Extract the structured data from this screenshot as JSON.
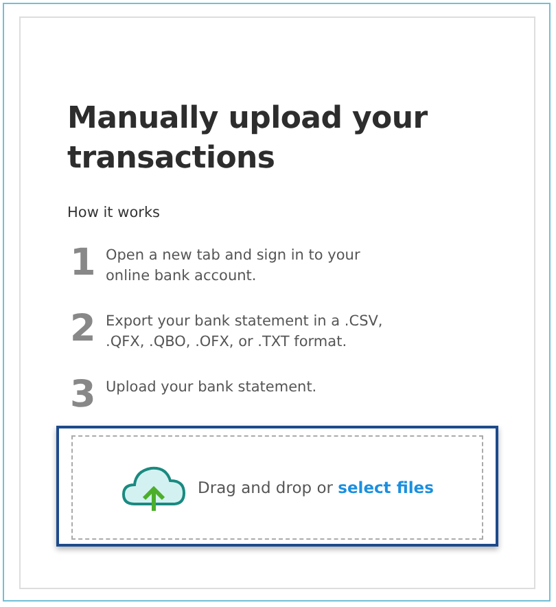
{
  "title": "Manually upload your transactions",
  "subtitle": "How it works",
  "steps": [
    {
      "number": "1",
      "text": "Open a new tab and sign in to your online bank account."
    },
    {
      "number": "2",
      "text": "Export your bank statement in a .CSV, .QFX, .QBO, .OFX, or .TXT format."
    },
    {
      "number": "3",
      "text": "Upload your bank statement."
    }
  ],
  "dropzone": {
    "text": "Drag and drop or",
    "link": "select files"
  }
}
